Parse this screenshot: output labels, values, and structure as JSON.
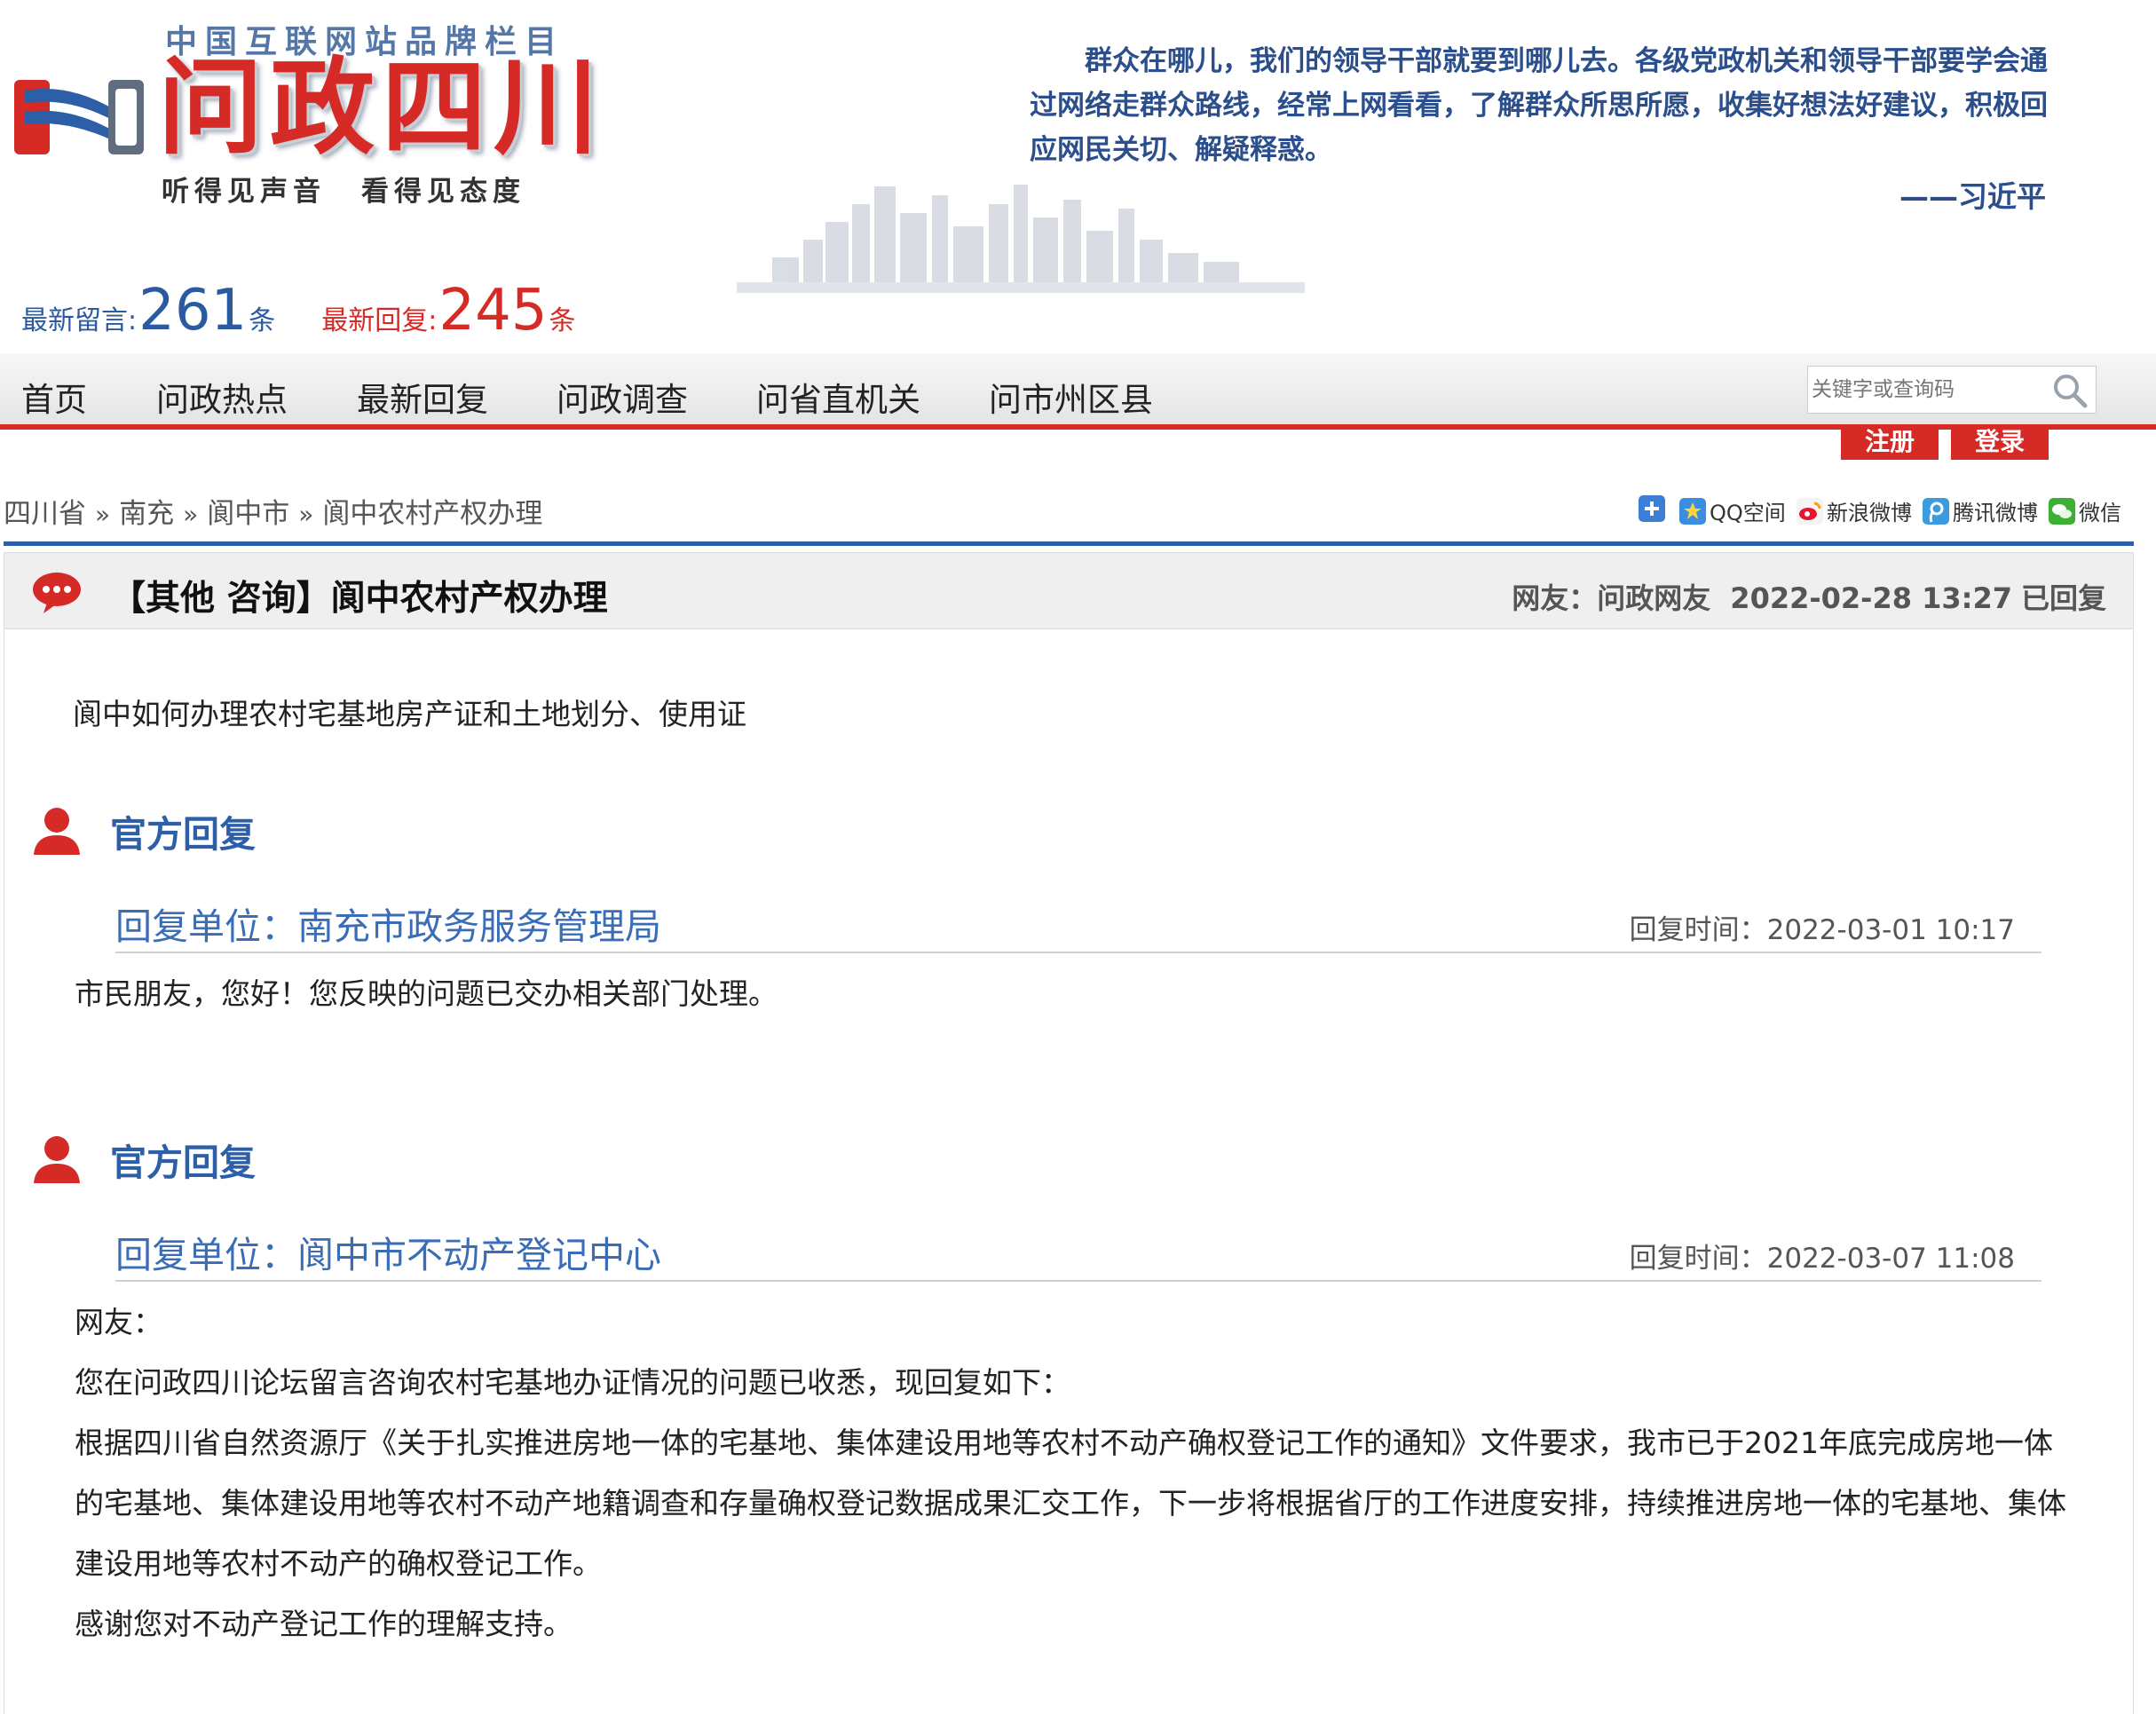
{
  "header": {
    "brand_tagline": "中国互联网站品牌栏目",
    "brand_title": "问政四川",
    "slogan_left": "听得见声音",
    "slogan_right": "看得见态度",
    "quote": "群众在哪儿，我们的领导干部就要到哪儿去。各级党政机关和领导干部要学会通过网络走群众路线，经常上网看看，了解群众所思所愿，收集好想法好建议，积极回应网民关切、解疑释惑。",
    "quote_author": "——习近平",
    "stats": {
      "latest_messages_label": "最新留言:",
      "latest_messages_count": "261",
      "latest_messages_unit": "条",
      "latest_replies_label": "最新回复:",
      "latest_replies_count": "245",
      "latest_replies_unit": "条"
    }
  },
  "nav": {
    "items": [
      "首页",
      "问政热点",
      "最新回复",
      "问政调查",
      "问省直机关",
      "问市州区县"
    ],
    "search_placeholder": "关键字或查询码",
    "register_label": "注册",
    "login_label": "登录"
  },
  "breadcrumb": [
    "四川省",
    "南充",
    "阆中市",
    "阆中农村产权办理"
  ],
  "share": {
    "qzone": "QQ空间",
    "sina": "新浪微博",
    "tencent": "腾讯微博",
    "wechat": "微信"
  },
  "post": {
    "title": "【其他 咨询】阆中农村产权办理",
    "author": "网友：问政网友",
    "datetime": "2022-02-28 13:27",
    "status": "已回复",
    "question": "阆中如何办理农村宅基地房产证和土地划分、使用证"
  },
  "replies": [
    {
      "heading": "官方回复",
      "unit": "回复单位：南充市政务服务管理局",
      "time": "回复时间：2022-03-01 10:17",
      "body": [
        "市民朋友，您好！您反映的问题已交办相关部门处理。"
      ]
    },
    {
      "heading": "官方回复",
      "unit": "回复单位：阆中市不动产登记中心",
      "time": "回复时间：2022-03-07 11:08",
      "body": [
        "网友：",
        "您在问政四川论坛留言咨询农村宅基地办证情况的问题已收悉，现回复如下：",
        "根据四川省自然资源厅《关于扎实推进房地一体的宅基地、集体建设用地等农村不动产确权登记工作的通知》文件要求，我市已于2021年底完成房地一体的宅基地、集体建设用地等农村不动产地籍调查和存量确权登记数据成果汇交工作，下一步将根据省厅的工作进度安排，持续推进房地一体的宅基地、集体建设用地等农村不动产的确权登记工作。",
        "感谢您对不动产登记工作的理解支持。"
      ]
    }
  ],
  "colors": {
    "brand_red": "#d62a27",
    "brand_blue": "#2d5fa8"
  }
}
